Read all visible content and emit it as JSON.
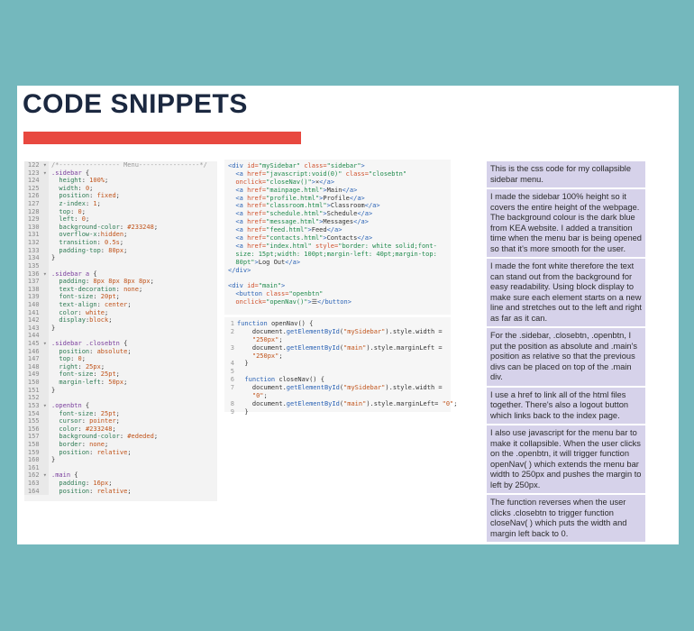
{
  "slide": {
    "title": "CODE SNIPPETS"
  },
  "css_code": [
    {
      "n": "122",
      "f": "▾",
      "t": [
        [
          "cmt",
          "/*---------------- Menu----------------*/"
        ]
      ]
    },
    {
      "n": "123",
      "f": "▾",
      "t": [
        [
          "sel",
          ".sidebar"
        ],
        [
          "plain",
          " {"
        ]
      ]
    },
    {
      "n": "124",
      "f": "",
      "t": [
        [
          "prop",
          "  height"
        ],
        [
          "plain",
          ": "
        ],
        [
          "val",
          "100%"
        ],
        [
          "plain",
          ";"
        ]
      ]
    },
    {
      "n": "125",
      "f": "",
      "t": [
        [
          "prop",
          "  width"
        ],
        [
          "plain",
          ": "
        ],
        [
          "val",
          "0"
        ],
        [
          "plain",
          ";"
        ]
      ]
    },
    {
      "n": "126",
      "f": "",
      "t": [
        [
          "prop",
          "  position"
        ],
        [
          "plain",
          ": "
        ],
        [
          "val",
          "fixed"
        ],
        [
          "plain",
          ";"
        ]
      ]
    },
    {
      "n": "127",
      "f": "",
      "t": [
        [
          "prop",
          "  z-index"
        ],
        [
          "plain",
          ": "
        ],
        [
          "val",
          "1"
        ],
        [
          "plain",
          ";"
        ]
      ]
    },
    {
      "n": "128",
      "f": "",
      "t": [
        [
          "prop",
          "  top"
        ],
        [
          "plain",
          ": "
        ],
        [
          "val",
          "0"
        ],
        [
          "plain",
          ";"
        ]
      ]
    },
    {
      "n": "129",
      "f": "",
      "t": [
        [
          "prop",
          "  left"
        ],
        [
          "plain",
          ": "
        ],
        [
          "val",
          "0"
        ],
        [
          "plain",
          ";"
        ]
      ]
    },
    {
      "n": "130",
      "f": "",
      "t": [
        [
          "prop",
          "  background-color"
        ],
        [
          "plain",
          ": "
        ],
        [
          "val",
          "#233248"
        ],
        [
          "plain",
          ";"
        ]
      ]
    },
    {
      "n": "131",
      "f": "",
      "t": [
        [
          "prop",
          "  overflow-x"
        ],
        [
          "plain",
          ":"
        ],
        [
          "val",
          "hidden"
        ],
        [
          "plain",
          ";"
        ]
      ]
    },
    {
      "n": "132",
      "f": "",
      "t": [
        [
          "prop",
          "  transition"
        ],
        [
          "plain",
          ": "
        ],
        [
          "val",
          "0.5s"
        ],
        [
          "plain",
          ";"
        ]
      ]
    },
    {
      "n": "133",
      "f": "",
      "t": [
        [
          "prop",
          "  padding-top"
        ],
        [
          "plain",
          ": "
        ],
        [
          "val",
          "80px"
        ],
        [
          "plain",
          ";"
        ]
      ]
    },
    {
      "n": "134",
      "f": "",
      "t": [
        [
          "plain",
          "}"
        ]
      ]
    },
    {
      "n": "135",
      "f": "",
      "t": [
        [
          "plain",
          ""
        ]
      ]
    },
    {
      "n": "136",
      "f": "▾",
      "t": [
        [
          "sel",
          ".sidebar a"
        ],
        [
          "plain",
          " {"
        ]
      ]
    },
    {
      "n": "137",
      "f": "",
      "t": [
        [
          "prop",
          "  padding"
        ],
        [
          "plain",
          ": "
        ],
        [
          "val",
          "8px 8px 8px 8px"
        ],
        [
          "plain",
          ";"
        ]
      ]
    },
    {
      "n": "138",
      "f": "",
      "t": [
        [
          "prop",
          "  text-decoration"
        ],
        [
          "plain",
          ": "
        ],
        [
          "val",
          "none"
        ],
        [
          "plain",
          ";"
        ]
      ]
    },
    {
      "n": "139",
      "f": "",
      "t": [
        [
          "prop",
          "  font-size"
        ],
        [
          "plain",
          ": "
        ],
        [
          "val",
          "20pt"
        ],
        [
          "plain",
          ";"
        ]
      ]
    },
    {
      "n": "140",
      "f": "",
      "t": [
        [
          "prop",
          "  text-align"
        ],
        [
          "plain",
          ": "
        ],
        [
          "val",
          "center"
        ],
        [
          "plain",
          ";"
        ]
      ]
    },
    {
      "n": "141",
      "f": "",
      "t": [
        [
          "prop",
          "  color"
        ],
        [
          "plain",
          ": "
        ],
        [
          "val",
          "white"
        ],
        [
          "plain",
          ";"
        ]
      ]
    },
    {
      "n": "142",
      "f": "",
      "t": [
        [
          "prop",
          "  display"
        ],
        [
          "plain",
          ":"
        ],
        [
          "val",
          "block"
        ],
        [
          "plain",
          ";"
        ]
      ]
    },
    {
      "n": "143",
      "f": "",
      "t": [
        [
          "plain",
          "}"
        ]
      ]
    },
    {
      "n": "144",
      "f": "",
      "t": [
        [
          "plain",
          ""
        ]
      ]
    },
    {
      "n": "145",
      "f": "▾",
      "t": [
        [
          "sel",
          ".sidebar .closebtn"
        ],
        [
          "plain",
          " {"
        ]
      ]
    },
    {
      "n": "146",
      "f": "",
      "t": [
        [
          "prop",
          "  position"
        ],
        [
          "plain",
          ": "
        ],
        [
          "val",
          "absolute"
        ],
        [
          "plain",
          ";"
        ]
      ]
    },
    {
      "n": "147",
      "f": "",
      "t": [
        [
          "prop",
          "  top"
        ],
        [
          "plain",
          ": "
        ],
        [
          "val",
          "0"
        ],
        [
          "plain",
          ";"
        ]
      ]
    },
    {
      "n": "148",
      "f": "",
      "t": [
        [
          "prop",
          "  right"
        ],
        [
          "plain",
          ": "
        ],
        [
          "val",
          "25px"
        ],
        [
          "plain",
          ";"
        ]
      ]
    },
    {
      "n": "149",
      "f": "",
      "t": [
        [
          "prop",
          "  font-size"
        ],
        [
          "plain",
          ": "
        ],
        [
          "val",
          "25pt"
        ],
        [
          "plain",
          ";"
        ]
      ]
    },
    {
      "n": "150",
      "f": "",
      "t": [
        [
          "prop",
          "  margin-left"
        ],
        [
          "plain",
          ": "
        ],
        [
          "val",
          "50px"
        ],
        [
          "plain",
          ";"
        ]
      ]
    },
    {
      "n": "151",
      "f": "",
      "t": [
        [
          "plain",
          "}"
        ]
      ]
    },
    {
      "n": "152",
      "f": "",
      "t": [
        [
          "plain",
          ""
        ]
      ]
    },
    {
      "n": "153",
      "f": "▾",
      "t": [
        [
          "sel",
          ".openbtn"
        ],
        [
          "plain",
          " {"
        ]
      ]
    },
    {
      "n": "154",
      "f": "",
      "t": [
        [
          "prop",
          "  font-size"
        ],
        [
          "plain",
          ": "
        ],
        [
          "val",
          "25pt"
        ],
        [
          "plain",
          ";"
        ]
      ]
    },
    {
      "n": "155",
      "f": "",
      "t": [
        [
          "prop",
          "  cursor"
        ],
        [
          "plain",
          ": "
        ],
        [
          "val",
          "pointer"
        ],
        [
          "plain",
          ";"
        ]
      ]
    },
    {
      "n": "156",
      "f": "",
      "t": [
        [
          "prop",
          "  color"
        ],
        [
          "plain",
          ": "
        ],
        [
          "val",
          "#233248"
        ],
        [
          "plain",
          ";"
        ]
      ]
    },
    {
      "n": "157",
      "f": "",
      "t": [
        [
          "prop",
          "  background-color"
        ],
        [
          "plain",
          ": "
        ],
        [
          "val",
          "#ededed"
        ],
        [
          "plain",
          ";"
        ]
      ]
    },
    {
      "n": "158",
      "f": "",
      "t": [
        [
          "prop",
          "  border"
        ],
        [
          "plain",
          ": "
        ],
        [
          "val",
          "none"
        ],
        [
          "plain",
          ";"
        ]
      ]
    },
    {
      "n": "159",
      "f": "",
      "t": [
        [
          "prop",
          "  position"
        ],
        [
          "plain",
          ": "
        ],
        [
          "val",
          "relative"
        ],
        [
          "plain",
          ";"
        ]
      ]
    },
    {
      "n": "160",
      "f": "",
      "t": [
        [
          "plain",
          "}"
        ]
      ]
    },
    {
      "n": "161",
      "f": "",
      "t": [
        [
          "plain",
          ""
        ]
      ]
    },
    {
      "n": "162",
      "f": "▾",
      "t": [
        [
          "sel",
          ".main"
        ],
        [
          "plain",
          " {"
        ]
      ]
    },
    {
      "n": "163",
      "f": "",
      "t": [
        [
          "prop",
          "  padding"
        ],
        [
          "plain",
          ": "
        ],
        [
          "val",
          "16px"
        ],
        [
          "plain",
          ";"
        ]
      ]
    },
    {
      "n": "164",
      "f": "",
      "t": [
        [
          "prop",
          "  position"
        ],
        [
          "plain",
          ": "
        ],
        [
          "val",
          "relative"
        ],
        [
          "plain",
          ";"
        ]
      ]
    }
  ],
  "html_code": [
    [
      [
        "tag",
        "<div "
      ],
      [
        "attr",
        "id="
      ],
      [
        "str",
        "\"mySidebar\" "
      ],
      [
        "attr",
        "class="
      ],
      [
        "str",
        "\"sidebar\""
      ],
      [
        "tag",
        ">"
      ]
    ],
    [
      [
        "tag",
        "  <a "
      ],
      [
        "attr",
        "href="
      ],
      [
        "str",
        "\"javascript:void(0)\" "
      ],
      [
        "attr",
        "class="
      ],
      [
        "str",
        "\"closebtn\""
      ]
    ],
    [
      [
        "attr",
        "  onclick="
      ],
      [
        "str",
        "\"closeNav()\""
      ],
      [
        "tag",
        ">"
      ],
      [
        "plain",
        "×"
      ],
      [
        "tag",
        "</a>"
      ]
    ],
    [
      [
        "tag",
        "  <a "
      ],
      [
        "attr",
        "href="
      ],
      [
        "str",
        "\"mainpage.html\""
      ],
      [
        "tag",
        ">"
      ],
      [
        "plain",
        "Main"
      ],
      [
        "tag",
        "</a>"
      ]
    ],
    [
      [
        "tag",
        "  <a "
      ],
      [
        "attr",
        "href="
      ],
      [
        "str",
        "\"profile.html\""
      ],
      [
        "tag",
        ">"
      ],
      [
        "plain",
        "Profile"
      ],
      [
        "tag",
        "</a>"
      ]
    ],
    [
      [
        "tag",
        "  <a "
      ],
      [
        "attr",
        "href="
      ],
      [
        "str",
        "\"classroom.html\""
      ],
      [
        "tag",
        ">"
      ],
      [
        "plain",
        "Classroom"
      ],
      [
        "tag",
        "</a>"
      ]
    ],
    [
      [
        "tag",
        "  <a "
      ],
      [
        "attr",
        "href="
      ],
      [
        "str",
        "\"schedule.html\""
      ],
      [
        "tag",
        ">"
      ],
      [
        "plain",
        "Schedule"
      ],
      [
        "tag",
        "</a>"
      ]
    ],
    [
      [
        "tag",
        "  <a "
      ],
      [
        "attr",
        "href="
      ],
      [
        "str",
        "\"message.html\""
      ],
      [
        "tag",
        ">"
      ],
      [
        "plain",
        "Messages"
      ],
      [
        "tag",
        "</a>"
      ]
    ],
    [
      [
        "tag",
        "  <a "
      ],
      [
        "attr",
        "href="
      ],
      [
        "str",
        "\"feed.html\""
      ],
      [
        "tag",
        ">"
      ],
      [
        "plain",
        "Feed"
      ],
      [
        "tag",
        "</a>"
      ]
    ],
    [
      [
        "tag",
        "  <a "
      ],
      [
        "attr",
        "href="
      ],
      [
        "str",
        "\"contacts.html\""
      ],
      [
        "tag",
        ">"
      ],
      [
        "plain",
        "Contacts"
      ],
      [
        "tag",
        "</a>"
      ]
    ],
    [
      [
        "tag",
        "  <a "
      ],
      [
        "attr",
        "href="
      ],
      [
        "str",
        "\"index.html\" "
      ],
      [
        "attr",
        "style="
      ],
      [
        "str",
        "\"border: white solid;font-"
      ]
    ],
    [
      [
        "str",
        "  size: 15pt;width: 100pt;margin-left: 40pt;margin-top:"
      ]
    ],
    [
      [
        "str",
        "  80pt\""
      ],
      [
        "tag",
        ">"
      ],
      [
        "plain",
        "Log Out"
      ],
      [
        "tag",
        "</a>"
      ]
    ],
    [
      [
        "tag",
        "</div>"
      ]
    ],
    [
      [
        "plain",
        ""
      ]
    ],
    [
      [
        "tag",
        "<div "
      ],
      [
        "attr",
        "id="
      ],
      [
        "str",
        "\"main\""
      ],
      [
        "tag",
        ">"
      ]
    ],
    [
      [
        "tag",
        "  <button "
      ],
      [
        "attr",
        "class="
      ],
      [
        "str",
        "\"openbtn\""
      ]
    ],
    [
      [
        "attr",
        "  onclick="
      ],
      [
        "str",
        "\"openNav()\""
      ],
      [
        "tag",
        ">"
      ],
      [
        "plain",
        "☰"
      ],
      [
        "tag",
        "</button>"
      ]
    ]
  ],
  "js_code": [
    {
      "n": "1",
      "t": [
        [
          "kw",
          "function "
        ],
        [
          "plain",
          "openNav() {"
        ]
      ]
    },
    {
      "n": "2",
      "t": [
        [
          "plain",
          "    document."
        ],
        [
          "fn",
          "getElementById"
        ],
        [
          "plain",
          "("
        ],
        [
          "jstr",
          "\"mySidebar\""
        ],
        [
          "plain",
          ").style.width = "
        ]
      ]
    },
    {
      "n": "",
      "t": [
        [
          "jstr",
          "    \"250px\""
        ],
        [
          "plain",
          ";"
        ]
      ]
    },
    {
      "n": "3",
      "t": [
        [
          "plain",
          "    document."
        ],
        [
          "fn",
          "getElementById"
        ],
        [
          "plain",
          "("
        ],
        [
          "jstr",
          "\"main\""
        ],
        [
          "plain",
          ").style.marginLeft = "
        ]
      ]
    },
    {
      "n": "",
      "t": [
        [
          "jstr",
          "    \"250px\""
        ],
        [
          "plain",
          ";"
        ]
      ]
    },
    {
      "n": "4",
      "t": [
        [
          "plain",
          "  }"
        ]
      ]
    },
    {
      "n": "5",
      "t": [
        [
          "plain",
          ""
        ]
      ]
    },
    {
      "n": "6",
      "t": [
        [
          "kw",
          "  function "
        ],
        [
          "plain",
          "closeNav() {"
        ]
      ]
    },
    {
      "n": "7",
      "t": [
        [
          "plain",
          "    document."
        ],
        [
          "fn",
          "getElementById"
        ],
        [
          "plain",
          "("
        ],
        [
          "jstr",
          "\"mySidebar\""
        ],
        [
          "plain",
          ").style.width = "
        ]
      ]
    },
    {
      "n": "",
      "t": [
        [
          "jstr",
          "    \"0\""
        ],
        [
          "plain",
          ";"
        ]
      ]
    },
    {
      "n": "8",
      "t": [
        [
          "plain",
          "    document."
        ],
        [
          "fn",
          "getElementById"
        ],
        [
          "plain",
          "("
        ],
        [
          "jstr",
          "\"main\""
        ],
        [
          "plain",
          ").style.marginLeft= "
        ],
        [
          "jstr",
          "\"0\""
        ],
        [
          "plain",
          ";"
        ]
      ]
    },
    {
      "n": "9",
      "t": [
        [
          "plain",
          "  }"
        ]
      ]
    }
  ],
  "notes": [
    "This is the css code for my collapsible sidebar menu.",
    "I made the sidebar 100% height so it covers the entire height of the webpage. The background colour is the dark blue from KEA website. I added a transition time when the menu bar is being opened so that it's more smooth for the user.",
    "I made the font white therefore the text can stand out from the background for easy readability. Using block display to make sure each element starts on a new line and stretches out to the left and right as far as it can.",
    "For the .sidebar, .closebtn, .openbtn, I put the position as absolute and .main's position as relative so that the previous divs can be placed on top of the .main div.",
    "I use a href to link all of the html files together. There's also a logout button which links back to the index page.",
    "I also use javascript for the menu bar to make it collapsible. When the user clicks on the .openbtn, it will trigger function openNav( ) which extends the menu bar width to 250px and pushes the margin to left by 250px.",
    "The function reverses when the user clicks .closebtn to trigger function closeNav( ) which puts the width and margin left back to 0."
  ],
  "colors": {
    "background": "#74b8bd",
    "title": "#1b2840",
    "accent_bar": "#e8483f",
    "note_bg": "#d6d2ea"
  }
}
